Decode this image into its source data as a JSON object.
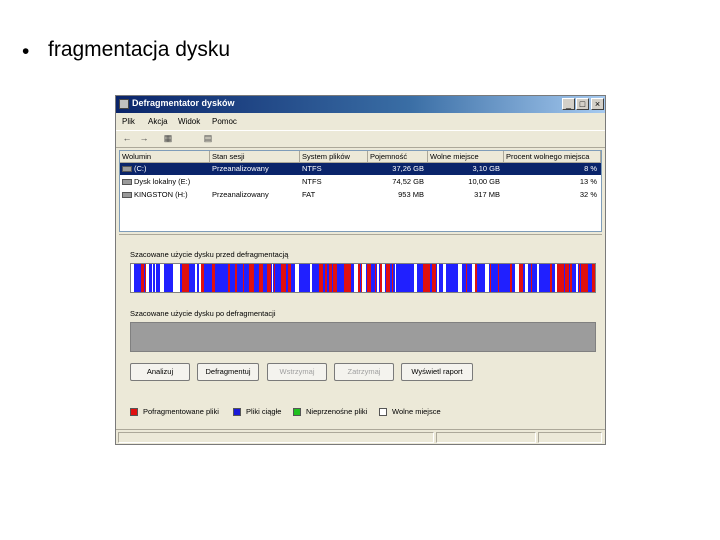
{
  "slide": {
    "bullet": "•",
    "title": "fragmentacja dysku"
  },
  "window": {
    "title": "Defragmentator dysków",
    "buttons": {
      "minimize": "_",
      "maximize": "□",
      "close": "×"
    },
    "menu": [
      "Plik",
      "Akcja",
      "Widok",
      "Pomoc"
    ],
    "toolbar": {
      "back": "←",
      "forward": "→",
      "tb1": "▦",
      "tb2": "▤"
    }
  },
  "volumes": {
    "headers": [
      "Wolumin",
      "Stan sesji",
      "System plików",
      "Pojemność",
      "Wolne miejsce",
      "Procent wolnego miejsca"
    ],
    "rows": [
      {
        "name": "(C:)",
        "status": "Przeanalizowany",
        "fs": "NTFS",
        "capacity": "37,26 GB",
        "free": "3,10 GB",
        "percent": "8 %",
        "selected": true
      },
      {
        "name": "Dysk lokalny (E:)",
        "status": "",
        "fs": "NTFS",
        "capacity": "74,52 GB",
        "free": "10,00 GB",
        "percent": "13 %",
        "selected": false
      },
      {
        "name": "KINGSTON (H:)",
        "status": "Przeanalizowany",
        "fs": "FAT",
        "capacity": "953 MB",
        "free": "317 MB",
        "percent": "32 %",
        "selected": false
      }
    ]
  },
  "analysis": {
    "before_label": "Szacowane użycie dysku przed defragmentacją",
    "after_label": "Szacowane użycie dysku po defragmentacji"
  },
  "actions": {
    "analyze": "Analizuj",
    "defragment": "Defragmentuj",
    "pause": "Wstrzymaj",
    "stop": "Zatrzymaj",
    "report": "Wyświetl raport"
  },
  "legend": [
    {
      "label": "Pofragmentowane pliki",
      "color": "#e01010"
    },
    {
      "label": "Pliki ciągłe",
      "color": "#1a1ad8"
    },
    {
      "label": "Nieprzenośne pliki",
      "color": "#20c020"
    },
    {
      "label": "Wolne miejsce",
      "color": "#ffffff"
    }
  ],
  "colors": {
    "titlebar": "#0a246a",
    "selection": "#0a246a",
    "fragmented": "#e01010",
    "contiguous": "#1a1ad8",
    "unmovable": "#20c020",
    "after_bar": "#9c9c9c"
  }
}
